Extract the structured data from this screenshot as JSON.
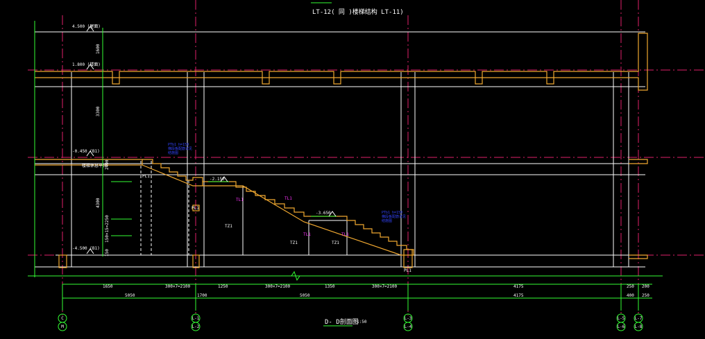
{
  "drawing": {
    "title": "LT-12( 同 )楼梯结构     LT-11)",
    "section_title": "D- D剖面图",
    "section_scale": "1:50",
    "colors": {
      "background": "#000000",
      "axis": "#e0206a",
      "structure": "#f0a830",
      "lines": "#ffffff",
      "dimensions": "#33ff33",
      "notes": "#3344ff",
      "tags": "#ff33ff"
    }
  },
  "levels": [
    {
      "id": "level-roof",
      "label": "4.500  (屋面)"
    },
    {
      "id": "level-floor",
      "label": "1.800  (楼面)"
    },
    {
      "id": "level-mid",
      "label": "-0.450   (B1)"
    },
    {
      "id": "level-landing",
      "label": "楼梯休息平台"
    },
    {
      "id": "level-base",
      "label": "-4.500  (B1)"
    }
  ],
  "left_dims": [
    "1600",
    "3300",
    "2400",
    "4300",
    "150×15=2250",
    "150"
  ],
  "stair_notes": {
    "left": [
      "PTb1 h=150",
      "梯段板配筋详见",
      "结施图"
    ],
    "right": [
      "PTb1 h=150",
      "梯段板配筋详见",
      "结施图"
    ]
  },
  "platform_levels": [
    "-2.150",
    "-3.650"
  ],
  "member_tags": [
    "TL1",
    "TL1",
    "TL1",
    "TL1"
  ],
  "small_labels": [
    "TZ1",
    "TZ1",
    "TZ1",
    "PL1",
    "PL1",
    "PL1"
  ],
  "dim_row1": [
    "1650",
    "300×7=2100",
    "1250",
    "300×7=2100",
    "1350",
    "300×7=2100",
    "4175",
    "250",
    "200"
  ],
  "dim_row2": [
    "5050",
    "1700",
    "5050",
    "4175",
    "400",
    "250"
  ],
  "axes": [
    {
      "id": "C",
      "sub": "M"
    },
    {
      "id": "L-1",
      "sub": "L-2"
    },
    {
      "id": "L-3",
      "sub": "L-4"
    },
    {
      "id": "L-5",
      "sub": "L-6"
    },
    {
      "id": "L-7",
      "sub": "L-8"
    }
  ]
}
